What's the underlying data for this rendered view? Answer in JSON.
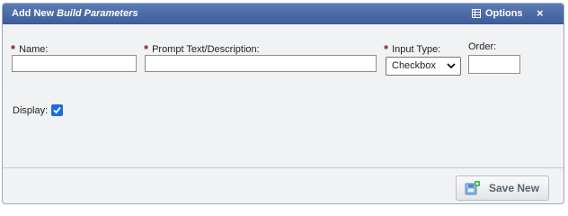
{
  "dialog": {
    "title_prefix": "Add New",
    "title_emphasis": "Build Parameters",
    "options_label": "Options",
    "close_symbol": "×"
  },
  "form": {
    "name_label": "Name:",
    "prompt_label": "Prompt Text/Description:",
    "input_type_label": "Input Type:",
    "order_label": "Order:",
    "required_marker": "*",
    "name_value": "",
    "prompt_value": "",
    "order_value": "",
    "input_type_selected": "Checkbox",
    "display_label": "Display:",
    "display_checked": true
  },
  "footer": {
    "save_label": "Save New"
  },
  "colors": {
    "titlebar": "#4a68a3",
    "required": "#8b1a1a",
    "checkbox": "#1a6fdd",
    "panel_bg": "#f1f2f4"
  },
  "icons": {
    "options": "grid-icon",
    "close": "close-icon",
    "select": "chevron-down-icon",
    "save": "save-new-icon",
    "check": "check-icon"
  }
}
